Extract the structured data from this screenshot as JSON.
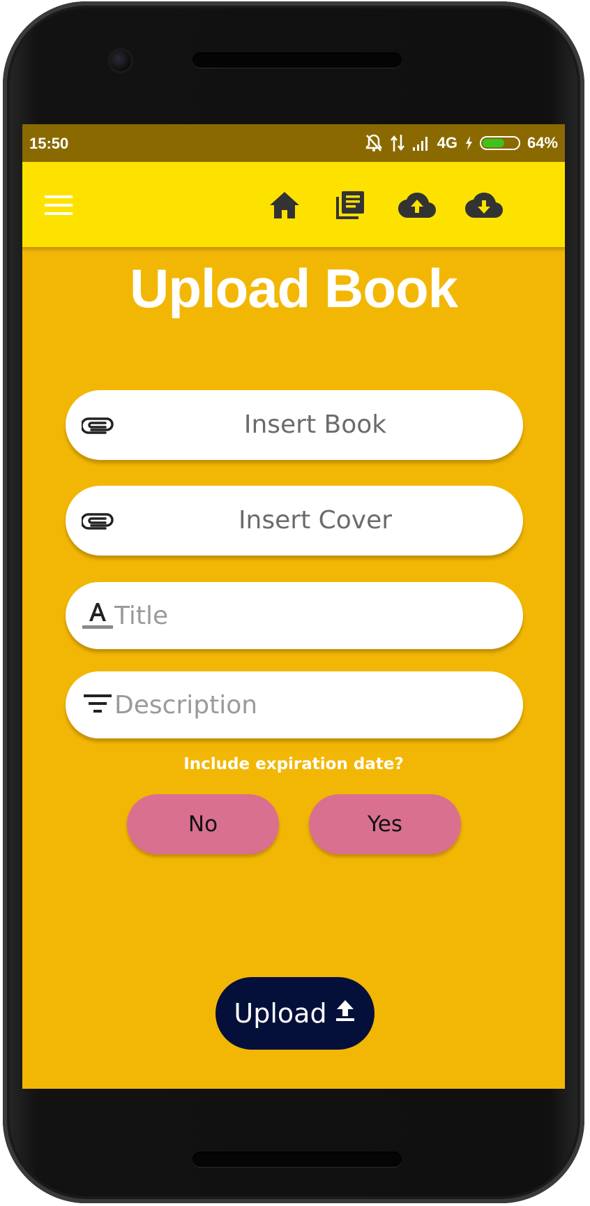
{
  "status_bar": {
    "time": "15:50",
    "network": "4G",
    "battery": "64%",
    "battery_level": 0.64,
    "icons": [
      "notifications-off-icon",
      "data-transfer-icon",
      "signal-icon",
      "charging-icon",
      "battery-icon"
    ]
  },
  "toolbar": {
    "icons": [
      "menu-icon",
      "home-icon",
      "library-icon",
      "cloud-upload-icon",
      "cloud-download-icon"
    ]
  },
  "page": {
    "title": "Upload Book"
  },
  "form": {
    "insert_book_label": "Insert Book",
    "insert_cover_label": "Insert Cover",
    "title_placeholder": "Title",
    "description_placeholder": "Description",
    "expiration_question": "Include expiration date?",
    "no_label": "No",
    "yes_label": "Yes",
    "upload_label": "Upload"
  },
  "colors": {
    "background": "#f2b705",
    "toolbar": "#fde200",
    "status_bar": "#8a6a00",
    "choice_button": "#d97090",
    "upload_button": "#05103a"
  }
}
